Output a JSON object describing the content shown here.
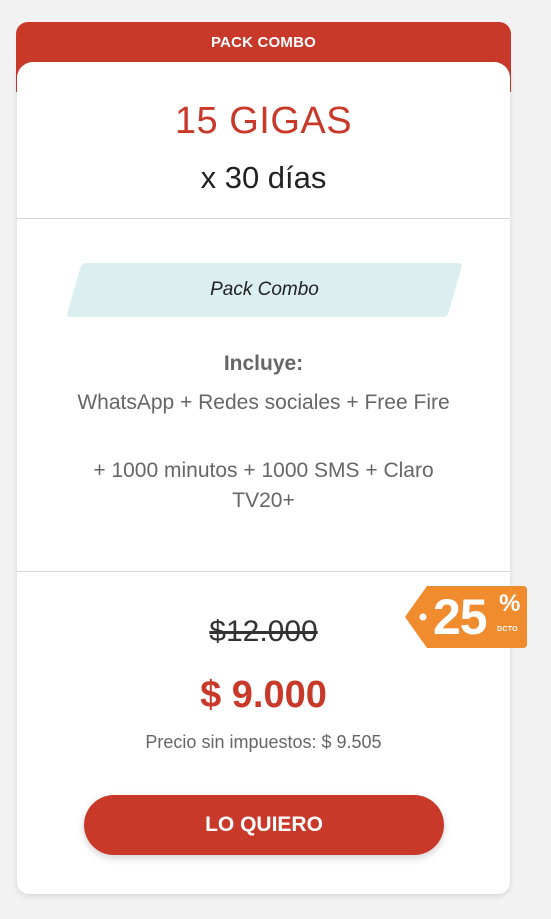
{
  "header": {
    "ribbon_label": "PACK COMBO"
  },
  "plan": {
    "data_amount": "15 GIGAS",
    "duration": "x 30 días"
  },
  "tag": {
    "label": "Pack Combo"
  },
  "includes": {
    "title": "Incluye:",
    "items": [
      "WhatsApp + Redes sociales + Free Fire",
      "+ 1000 minutos + 1000 SMS + Claro TV20+"
    ]
  },
  "pricing": {
    "old_price": "$12.000",
    "price": "$ 9.000",
    "tax_note": "Precio sin impuestos: $ 9.505"
  },
  "discount": {
    "value": "25",
    "percent_sign": "%",
    "caption": "DCTO"
  },
  "cta": {
    "label": "LO QUIERO"
  },
  "colors": {
    "brand_red": "#c9392a",
    "discount_orange": "#f08b2e",
    "tag_background": "#dbeef0",
    "page_background": "#f2f2f2"
  }
}
